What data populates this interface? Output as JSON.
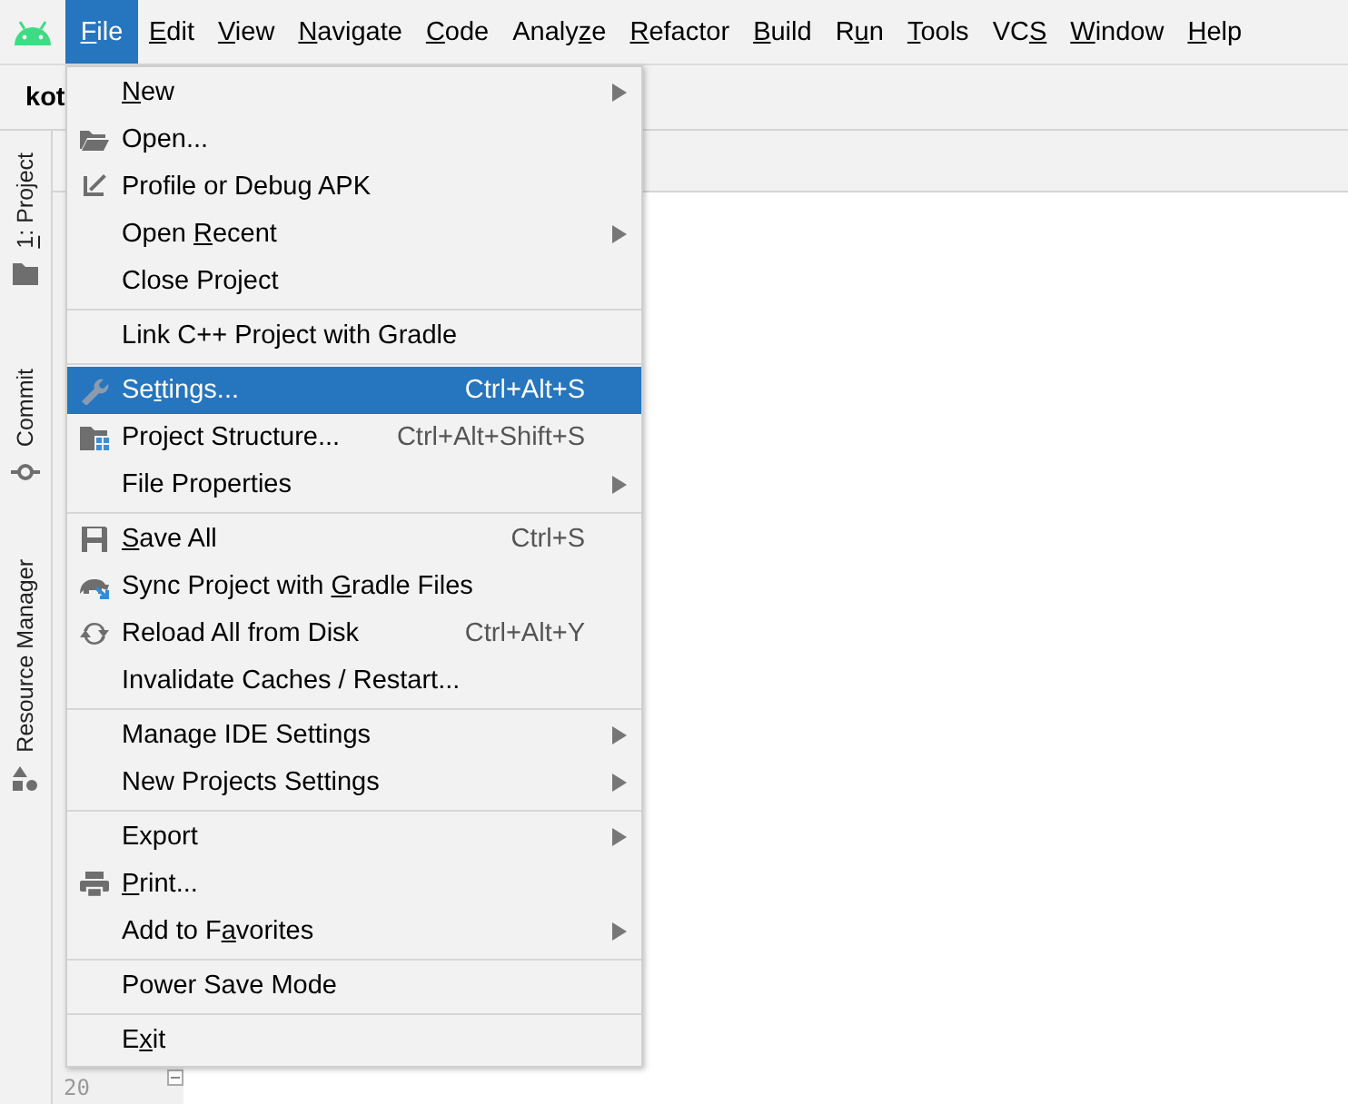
{
  "menu_bar": {
    "items": [
      {
        "key": "F",
        "after": "ile",
        "selected": true
      },
      {
        "key": "E",
        "after": "dit",
        "selected": false
      },
      {
        "key": "V",
        "after": "iew",
        "selected": false
      },
      {
        "key": "N",
        "after": "avigate",
        "selected": false
      },
      {
        "key": "C",
        "after": "ode",
        "selected": false
      },
      {
        "before": "Analy",
        "key": "z",
        "after": "e",
        "selected": false
      },
      {
        "key": "R",
        "after": "efactor",
        "selected": false
      },
      {
        "key": "B",
        "after": "uild",
        "selected": false
      },
      {
        "before": "R",
        "key": "u",
        "after": "n",
        "selected": false
      },
      {
        "key": "T",
        "after": "ools",
        "selected": false
      },
      {
        "before": "VC",
        "key": "S",
        "selected": false
      },
      {
        "key": "W",
        "after": "indow",
        "selected": false
      },
      {
        "key": "H",
        "after": "elp",
        "selected": false
      }
    ]
  },
  "toolbar": {
    "project_name": "kot"
  },
  "tool_strip": [
    {
      "key": "1",
      "after": ": Project"
    },
    {
      "label": "Commit"
    },
    {
      "label": "Resource Manager"
    }
  ],
  "gutter": {
    "line_number": "20"
  },
  "file_menu": {
    "groups": [
      [
        {
          "key": "N",
          "after": "ew",
          "submenu": true,
          "selected": false
        },
        {
          "label": "Open...",
          "submenu": false,
          "selected": false
        },
        {
          "label": "Profile or Debug APK",
          "submenu": false,
          "selected": false
        },
        {
          "before": "Open ",
          "key": "R",
          "after": "ecent",
          "submenu": true,
          "selected": false
        },
        {
          "label": "Close Project",
          "submenu": false,
          "selected": false
        }
      ],
      [
        {
          "label": "Link C++ Project with Gradle",
          "submenu": false,
          "selected": false
        }
      ],
      [
        {
          "before": "Se",
          "key": "t",
          "after": "tings...",
          "shortcut": "Ctrl+Alt+S",
          "submenu": false,
          "selected": true
        },
        {
          "label": "Project Structure...",
          "shortcut": "Ctrl+Alt+Shift+S",
          "submenu": false,
          "selected": false
        },
        {
          "label": "File Properties",
          "submenu": true,
          "selected": false
        }
      ],
      [
        {
          "key": "S",
          "after": "ave All",
          "shortcut": "Ctrl+S",
          "submenu": false,
          "selected": false
        },
        {
          "before": "Sync Project with ",
          "key": "G",
          "after": "radle Files",
          "submenu": false,
          "selected": false
        },
        {
          "label": "Reload All from Disk",
          "shortcut": "Ctrl+Alt+Y",
          "submenu": false,
          "selected": false
        },
        {
          "label": "Invalidate Caches / Restart...",
          "submenu": false,
          "selected": false
        }
      ],
      [
        {
          "label": "Manage IDE Settings",
          "submenu": true,
          "selected": false
        },
        {
          "label": "New Projects Settings",
          "submenu": true,
          "selected": false
        }
      ],
      [
        {
          "label": "Export",
          "submenu": true,
          "selected": false
        },
        {
          "key": "P",
          "after": "rint...",
          "submenu": false,
          "selected": false
        },
        {
          "before": "Add to F",
          "key": "a",
          "after": "vorites",
          "submenu": true,
          "selected": false
        }
      ],
      [
        {
          "label": "Power Save Mode",
          "submenu": false,
          "selected": false
        }
      ],
      [
        {
          "before": "E",
          "key": "x",
          "after": "it",
          "submenu": false,
          "selected": false
        }
      ]
    ]
  }
}
